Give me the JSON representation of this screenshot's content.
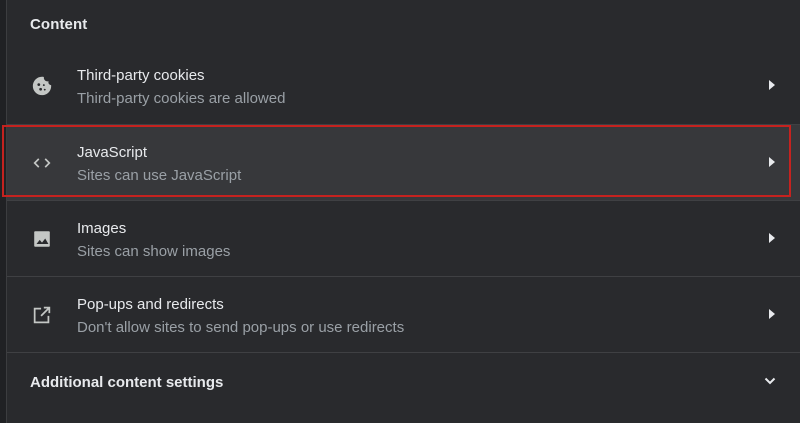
{
  "section": {
    "title": "Content"
  },
  "rows": [
    {
      "icon": "cookie-icon",
      "title": "Third-party cookies",
      "subtitle": "Third-party cookies are allowed"
    },
    {
      "icon": "code-icon",
      "title": "JavaScript",
      "subtitle": "Sites can use JavaScript",
      "highlighted": true
    },
    {
      "icon": "image-icon",
      "title": "Images",
      "subtitle": "Sites can show images"
    },
    {
      "icon": "open-in-new-icon",
      "title": "Pop-ups and redirects",
      "subtitle": "Don't allow sites to send pop-ups or use redirects"
    }
  ],
  "additional": {
    "label": "Additional content settings",
    "icon": "chevron-down-icon"
  },
  "colors": {
    "background": "#202124",
    "panel": "#292a2d",
    "text_primary": "#e8eaed",
    "text_secondary": "#9aa0a6",
    "highlight_border": "#c5221f"
  }
}
